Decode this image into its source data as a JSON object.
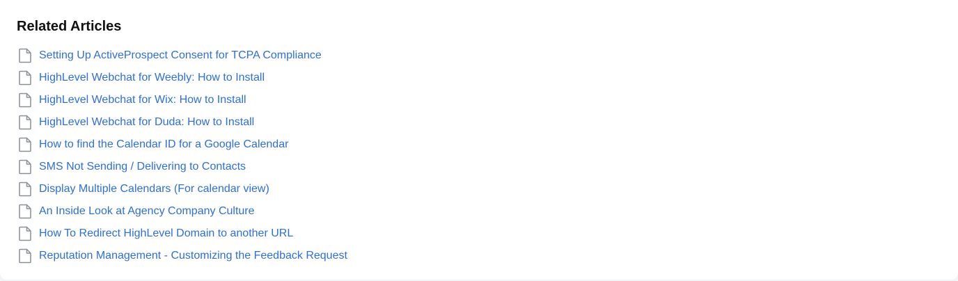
{
  "section": {
    "title": "Related Articles"
  },
  "icons": {
    "article": "document-icon"
  },
  "colors": {
    "link": "#2f6fcf",
    "icon": "#8a8f98",
    "title": "#111111"
  },
  "articles": [
    {
      "label": "Setting Up ActiveProspect Consent for TCPA Compliance"
    },
    {
      "label": "HighLevel Webchat for Weebly: How to Install"
    },
    {
      "label": "HighLevel Webchat for Wix: How to Install"
    },
    {
      "label": "HighLevel Webchat for Duda: How to Install"
    },
    {
      "label": "How to find the Calendar ID for a Google Calendar"
    },
    {
      "label": "SMS Not Sending / Delivering to Contacts"
    },
    {
      "label": "Display Multiple Calendars (For calendar view)"
    },
    {
      "label": "An Inside Look at Agency Company Culture"
    },
    {
      "label": "How To Redirect HighLevel Domain to another URL"
    },
    {
      "label": "Reputation Management - Customizing the Feedback Request"
    }
  ]
}
